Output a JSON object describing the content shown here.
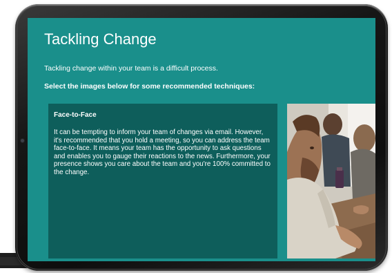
{
  "page": {
    "title": "Tackling Change",
    "intro": "Tackling change within your team is a difficult process.",
    "instruction": "Select the images below for some recommended techniques:"
  },
  "panel": {
    "heading": "Face-to-Face",
    "body": "It can be tempting to inform your team of changes via email. However, it's recommended that you hold a meeting, so you can address the team face-to-face. It means your team has the opportunity to ask questions and enables you to gauge their reactions to the news. Furthermore, your presence shows you care about the team and you're 100% committed to the change."
  },
  "colors": {
    "screen_background": "#1a8f8b",
    "panel_background": "#0e5e5b",
    "text": "#ffffff",
    "device_frame": "#161616"
  },
  "media": {
    "photo_icon": "meeting-photo"
  }
}
